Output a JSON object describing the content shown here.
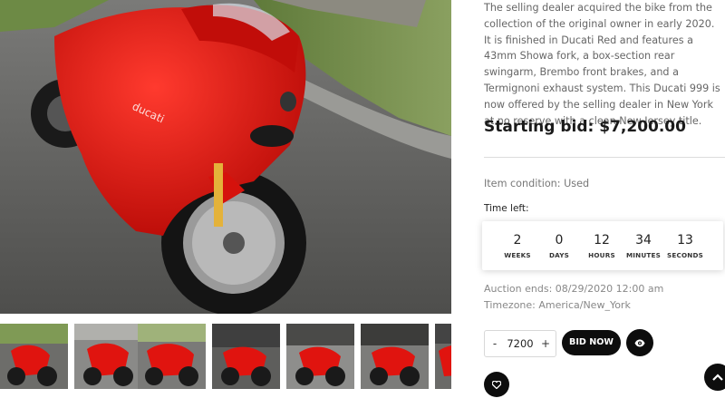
{
  "listing": {
    "description": "The selling dealer acquired the bike from the collection of the original owner in early 2020. It is finished in Ducati Red and features a 43mm Showa fork, a box-section rear swingarm, Brembo front brakes, and a Termignoni exhaust system. This Ducati 999 is now offered by the selling dealer in New York at no reserve with a clean New Jersey title.",
    "starting_bid": "Starting bid: $7,200.00",
    "condition": "Item condition: Used",
    "time_left_label": "Time left:",
    "countdown": [
      {
        "value": "2",
        "unit": "WEEKS"
      },
      {
        "value": "0",
        "unit": "DAYS"
      },
      {
        "value": "12",
        "unit": "HOURS"
      },
      {
        "value": "34",
        "unit": "MINUTES"
      },
      {
        "value": "13",
        "unit": "SECONDS"
      }
    ],
    "auction_ends": "Auction ends: 08/29/2020 12:00 am",
    "timezone": "Timezone: America/New_York"
  },
  "bid_form": {
    "minus_label": "-",
    "plus_label": "+",
    "quantity_value": "7200",
    "bid_button_label": "BID NOW"
  },
  "icons": {
    "watch": "eye-icon",
    "favorite": "heart-icon",
    "scroll_top": "chevron-up-icon"
  },
  "gallery": {
    "main_image": "red-ducati-999-motorcycle",
    "thumbnail_count": 7
  },
  "colors": {
    "accent": "#0d0d0d",
    "bike_red": "#e0140f",
    "muted_text": "#777777"
  }
}
